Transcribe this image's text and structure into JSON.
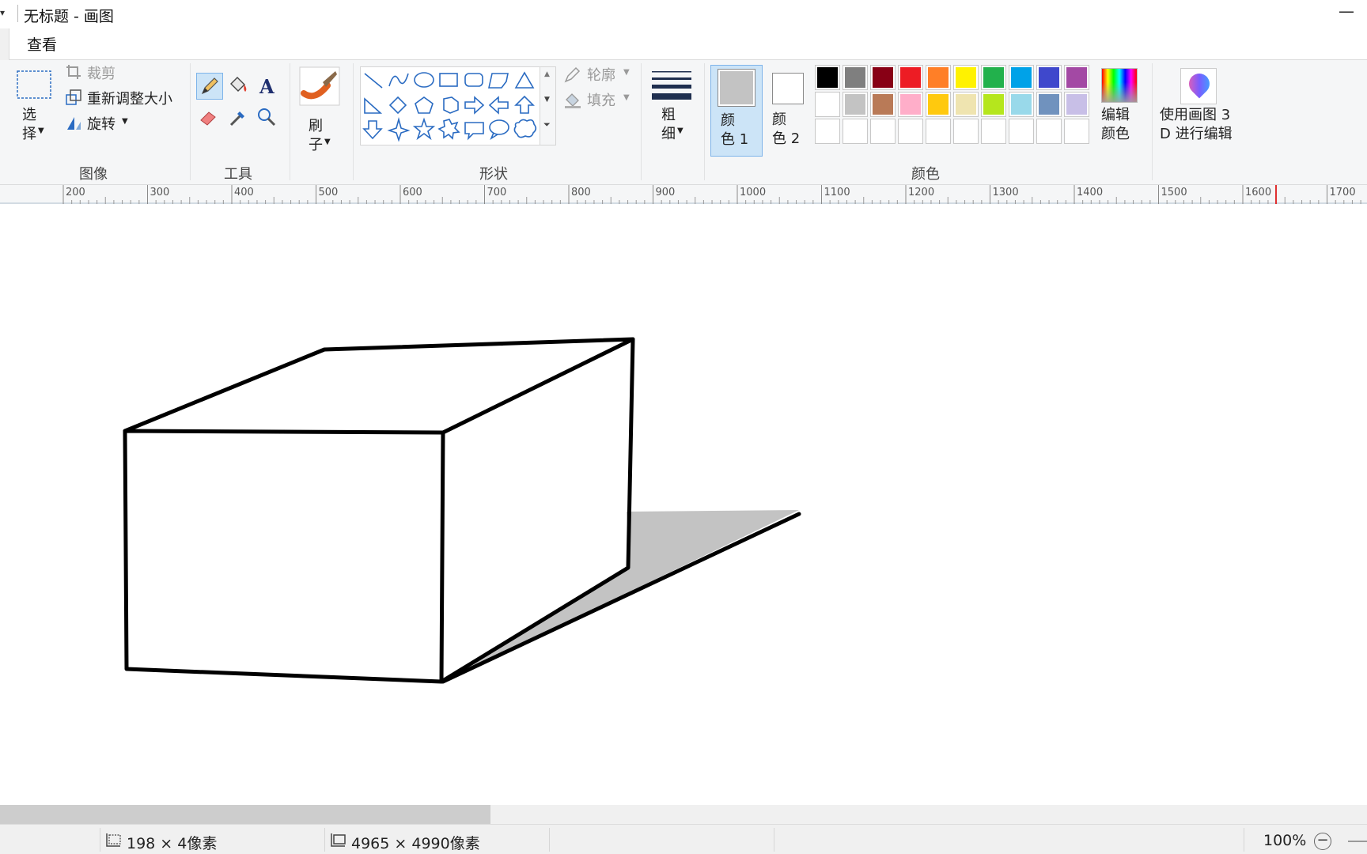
{
  "window": {
    "title": "无标题 - 画图",
    "quick_access": "▾",
    "minimize": "—"
  },
  "tabs": {
    "view": "查看"
  },
  "image_group": {
    "label": "图像",
    "select": "选\n择",
    "crop": "裁剪",
    "resize": "重新调整大小",
    "rotate": "旋转"
  },
  "tools_group": {
    "label": "工具"
  },
  "brush": {
    "label": "刷\n子"
  },
  "shapes_group": {
    "label": "形状",
    "outline": "轮廓",
    "fill": "填充"
  },
  "size": {
    "label": "粗\n细"
  },
  "colors_group": {
    "label": "颜色",
    "color1": "颜\n色 1",
    "color2": "颜\n色 2",
    "color1_value": "#c3c3c3",
    "color2_value": "#ffffff",
    "edit_colors": "编辑\n颜色",
    "paint3d": "使用画图 3\nD 进行编辑",
    "palette_row1": [
      "#000000",
      "#7f7f7f",
      "#880015",
      "#ed1c24",
      "#ff7f27",
      "#fff200",
      "#22b14c",
      "#00a2e8",
      "#3f48cc",
      "#a349a4"
    ],
    "palette_row2": [
      "#ffffff",
      "#c3c3c3",
      "#b97a57",
      "#ffaec9",
      "#ffc90e",
      "#efe4b0",
      "#b5e61d",
      "#99d9ea",
      "#7092be",
      "#c8bfe7"
    ],
    "palette_row3": [
      "#ffffff",
      "#ffffff",
      "#ffffff",
      "#ffffff",
      "#ffffff",
      "#ffffff",
      "#ffffff",
      "#ffffff",
      "#ffffff",
      "#ffffff"
    ]
  },
  "ruler": {
    "labels": [
      "200",
      "300",
      "400",
      "500",
      "600",
      "700",
      "800",
      "900",
      "1000",
      "1100",
      "1200",
      "1300",
      "1400",
      "1500",
      "1600",
      "1700"
    ]
  },
  "status": {
    "selection_size": "198 × 4像素",
    "image_size": "4965 × 4990像素",
    "zoom": "100%",
    "zoom_out": "−"
  }
}
